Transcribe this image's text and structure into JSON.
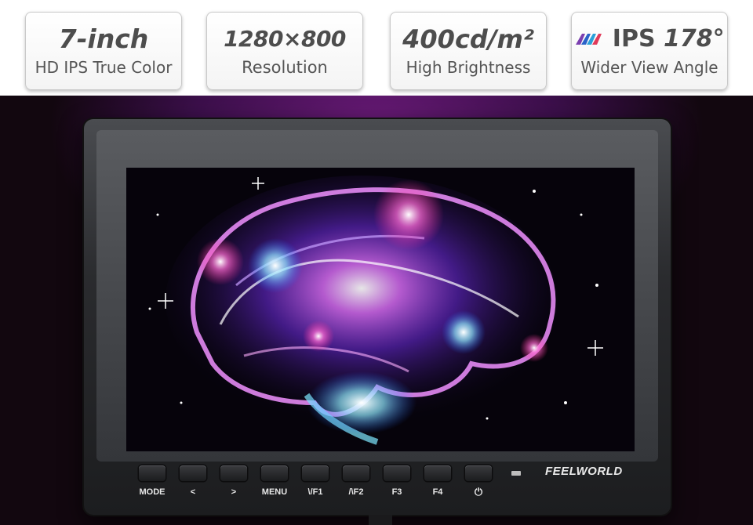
{
  "features": [
    {
      "headline": "7-inch",
      "caption": "HD IPS True Color"
    },
    {
      "headline": "1280×800",
      "caption": "Resolution"
    },
    {
      "headline": "400cd/m²",
      "caption": "High Brightness"
    },
    {
      "logo": "IPS",
      "headline": "178°",
      "caption": "Wider View Angle"
    }
  ],
  "monitor": {
    "brand": "FEELWORLD",
    "screen_image": "glowing-brain-illustration",
    "buttons": [
      {
        "label": "MODE"
      },
      {
        "label": "<"
      },
      {
        "label": ">"
      },
      {
        "label": "MENU"
      },
      {
        "label": "\\/F1"
      },
      {
        "label": "/\\F2"
      },
      {
        "label": "F3"
      },
      {
        "label": "F4"
      },
      {
        "label": "⏻",
        "icon": "power-icon"
      }
    ]
  },
  "colors": {
    "card_text": "#4d4d4d",
    "ips_logo_stripes": [
      "#7b3fb0",
      "#2a62c8",
      "#2aa0d8",
      "#e03a5a"
    ],
    "scene_glow": "#6a1a78",
    "bezel": "#2a2b2e"
  }
}
